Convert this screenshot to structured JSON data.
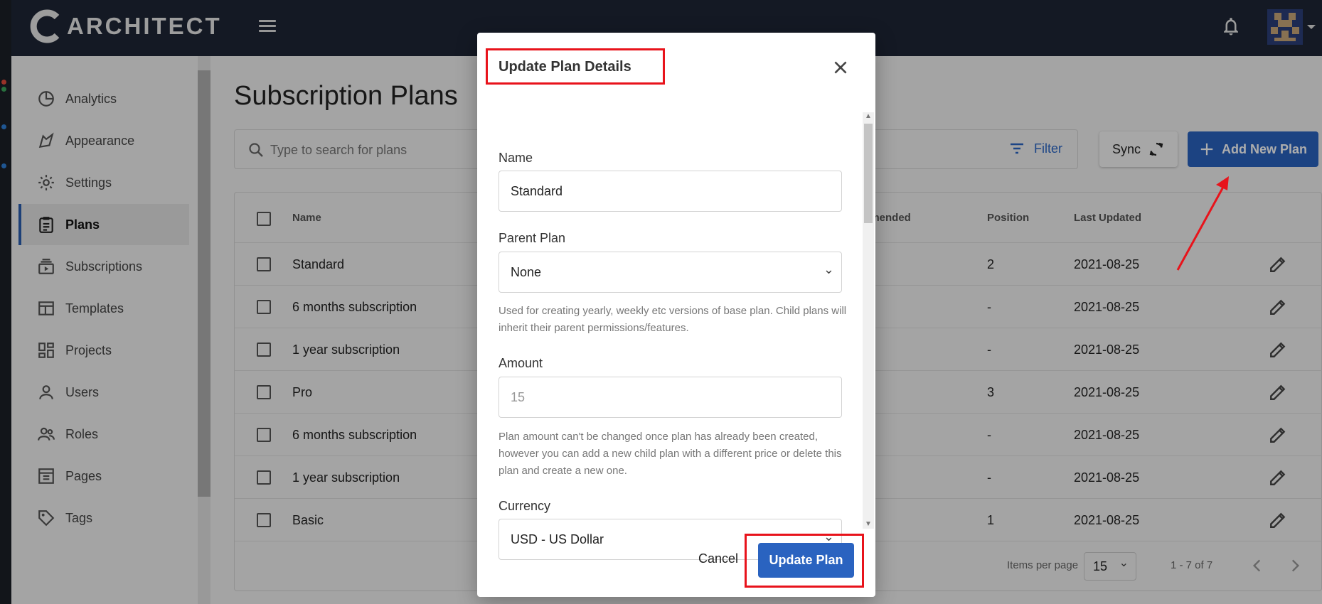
{
  "app": {
    "name": "ARCHITECT"
  },
  "sidebar": {
    "items": [
      {
        "label": "Analytics",
        "icon": "analytics-icon"
      },
      {
        "label": "Appearance",
        "icon": "appearance-icon"
      },
      {
        "label": "Settings",
        "icon": "gear-icon"
      },
      {
        "label": "Plans",
        "icon": "clipboard-icon",
        "active": true
      },
      {
        "label": "Subscriptions",
        "icon": "subscriptions-icon"
      },
      {
        "label": "Templates",
        "icon": "templates-icon"
      },
      {
        "label": "Projects",
        "icon": "projects-icon"
      },
      {
        "label": "Users",
        "icon": "user-icon"
      },
      {
        "label": "Roles",
        "icon": "people-icon"
      },
      {
        "label": "Pages",
        "icon": "pages-icon"
      },
      {
        "label": "Tags",
        "icon": "tag-icon"
      }
    ]
  },
  "main": {
    "title": "Subscription Plans",
    "search_placeholder": "Type to search for plans",
    "filter_label": "Filter",
    "sync_label": "Sync",
    "add_label": "Add New Plan"
  },
  "table": {
    "headers": {
      "name": "Name",
      "recommended": "mmended",
      "position": "Position",
      "updated": "Last Updated"
    },
    "rows": [
      {
        "name": "Standard",
        "position": "2",
        "updated": "2021-08-25"
      },
      {
        "name": "6 months subscription",
        "position": "-",
        "updated": "2021-08-25"
      },
      {
        "name": "1 year subscription",
        "position": "-",
        "updated": "2021-08-25"
      },
      {
        "name": "Pro",
        "position": "3",
        "updated": "2021-08-25"
      },
      {
        "name": "6 months subscription",
        "position": "-",
        "updated": "2021-08-25"
      },
      {
        "name": "1 year subscription",
        "position": "-",
        "updated": "2021-08-25"
      },
      {
        "name": "Basic",
        "position": "1",
        "updated": "2021-08-25"
      }
    ],
    "pager": {
      "items_per_page_label": "Items per page",
      "items_per_page": "15",
      "range": "1 - 7 of 7"
    }
  },
  "modal": {
    "title": "Update Plan Details",
    "name_label": "Name",
    "name_value": "Standard",
    "parent_label": "Parent Plan",
    "parent_value": "None",
    "parent_hint": "Used for creating yearly, weekly etc versions of base plan. Child plans will inherit their parent permissions/features.",
    "amount_label": "Amount",
    "amount_value": "15",
    "amount_hint": "Plan amount can't be changed once plan has already been created, however you can add a new child plan with a different price or delete this plan and create a new one.",
    "currency_label": "Currency",
    "currency_value": "USD - US Dollar",
    "cancel_label": "Cancel",
    "submit_label": "Update Plan"
  },
  "colors": {
    "primary": "#2a63c0",
    "topbar": "#1e2636",
    "highlight": "#e8131b"
  }
}
